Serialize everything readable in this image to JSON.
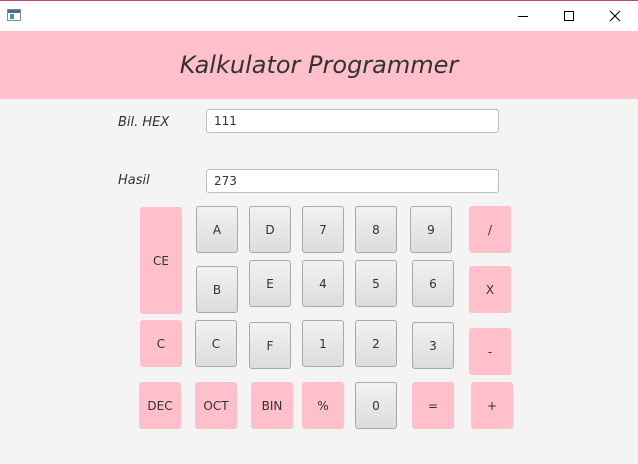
{
  "window": {
    "minimize_icon": "minimize-icon",
    "maximize_icon": "maximize-icon",
    "close_icon": "close-icon"
  },
  "header": {
    "title": "Kalkulator Programmer",
    "background": "#ffc0cb"
  },
  "form": {
    "hex_label": "Bil. HEX",
    "hex_value": "111",
    "result_label": "Hasil",
    "result_value": "273"
  },
  "keys": {
    "ce": "CE",
    "c_clear": "C",
    "dec": "DEC",
    "a": "A",
    "b": "B",
    "c_hex": "C",
    "oct": "OCT",
    "d": "D",
    "e": "E",
    "f": "F",
    "bin": "BIN",
    "seven": "7",
    "four": "4",
    "one": "1",
    "percent": "%",
    "eight": "8",
    "five": "5",
    "two": "2",
    "zero": "0",
    "nine": "9",
    "six": "6",
    "three": "3",
    "equals": "=",
    "divide": "/",
    "multiply": "X",
    "minus": "-",
    "plus": "+"
  },
  "colors": {
    "accent_pink": "#ffc0cb",
    "gray_button": "#e6e6e6"
  }
}
